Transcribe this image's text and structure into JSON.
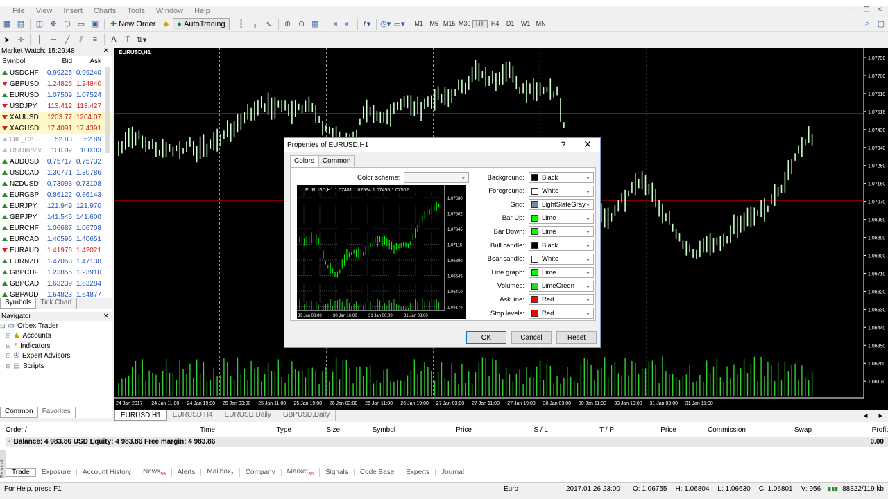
{
  "menu": [
    "File",
    "View",
    "Insert",
    "Charts",
    "Tools",
    "Window",
    "Help"
  ],
  "toolbar": {
    "new_order": "New Order",
    "autotrading": "AutoTrading",
    "timeframes": [
      "M1",
      "M5",
      "M15",
      "M30",
      "H1",
      "H4",
      "D1",
      "W1",
      "MN"
    ],
    "selected_tf": "H1"
  },
  "market_watch": {
    "title": "Market Watch: 15:29:48",
    "columns": [
      "Symbol",
      "Bid",
      "Ask"
    ],
    "rows": [
      {
        "s": "USDCHF",
        "bid": "0.99225",
        "ask": "0.99240",
        "dir": "up",
        "hl": false
      },
      {
        "s": "GBPUSD",
        "bid": "1.24825",
        "ask": "1.24840",
        "dir": "dn",
        "hl": false
      },
      {
        "s": "EURUSD",
        "bid": "1.07509",
        "ask": "1.07524",
        "dir": "up",
        "hl": false
      },
      {
        "s": "USDJPY",
        "bid": "113.412",
        "ask": "113.427",
        "dir": "dn",
        "hl": false
      },
      {
        "s": "XAUUSD",
        "bid": "1203.77",
        "ask": "1204.07",
        "dir": "dn",
        "hl": true
      },
      {
        "s": "XAGUSD",
        "bid": "17.4091",
        "ask": "17.4391",
        "dir": "dn",
        "hl": true
      },
      {
        "s": "OIL_Ch...",
        "bid": "52.83",
        "ask": "52.89",
        "dir": "gr",
        "hl": false
      },
      {
        "s": "USDIndex",
        "bid": "100.02",
        "ask": "100.03",
        "dir": "gr",
        "hl": false
      },
      {
        "s": "AUDUSD",
        "bid": "0.75717",
        "ask": "0.75732",
        "dir": "up",
        "hl": false
      },
      {
        "s": "USDCAD",
        "bid": "1.30771",
        "ask": "1.30786",
        "dir": "up",
        "hl": false
      },
      {
        "s": "NZDUSD",
        "bid": "0.73093",
        "ask": "0.73108",
        "dir": "up",
        "hl": false
      },
      {
        "s": "EURGBP",
        "bid": "0.86122",
        "ask": "0.86143",
        "dir": "up",
        "hl": false
      },
      {
        "s": "EURJPY",
        "bid": "121.949",
        "ask": "121.970",
        "dir": "up",
        "hl": false
      },
      {
        "s": "GBPJPY",
        "bid": "141.545",
        "ask": "141.600",
        "dir": "up",
        "hl": false
      },
      {
        "s": "EURCHF",
        "bid": "1.06687",
        "ask": "1.06708",
        "dir": "up",
        "hl": false
      },
      {
        "s": "EURCAD",
        "bid": "1.40596",
        "ask": "1.40651",
        "dir": "up",
        "hl": false
      },
      {
        "s": "EURAUD",
        "bid": "1.41976",
        "ask": "1.42021",
        "dir": "dn",
        "hl": false
      },
      {
        "s": "EURNZD",
        "bid": "1.47053",
        "ask": "1.47138",
        "dir": "up",
        "hl": false
      },
      {
        "s": "GBPCHF",
        "bid": "1.23855",
        "ask": "1.23910",
        "dir": "up",
        "hl": false
      },
      {
        "s": "GBPCAD",
        "bid": "1.63239",
        "ask": "1.63284",
        "dir": "up",
        "hl": false
      },
      {
        "s": "GBPAUD",
        "bid": "1.64823",
        "ask": "1.64877",
        "dir": "up",
        "hl": false
      }
    ],
    "tabs": [
      "Symbols",
      "Tick Chart"
    ]
  },
  "navigator": {
    "title": "Navigator",
    "items": [
      "Orbex Trader",
      "Accounts",
      "Indicators",
      "Expert Advisors",
      "Scripts"
    ],
    "tabs": [
      "Common",
      "Favorites"
    ]
  },
  "chart": {
    "title": "EURUSD,H1",
    "price_labels": [
      "1.07790",
      "1.07700",
      "1.07610",
      "1.07516",
      "1.07430",
      "1.07340",
      "1.07250",
      "1.07160",
      "1.07070",
      "1.06980",
      "1.06890",
      "1.06800",
      "1.06710",
      "1.06620",
      "1.06530",
      "1.06440",
      "1.06350",
      "1.06260",
      "1.06170"
    ],
    "time_labels": [
      "24 Jan 2017",
      "24 Jan 11:00",
      "24 Jan 19:00",
      "25 Jan 03:00",
      "25 Jan 11:00",
      "25 Jan 19:00",
      "26 Jan 03:00",
      "26 Jan 11:00",
      "26 Jan 19:00",
      "27 Jan 03:00",
      "27 Jan 11:00",
      "27 Jan 19:00",
      "30 Jan 03:00",
      "30 Jan 11:00",
      "30 Jan 19:00",
      "31 Jan 03:00",
      "31 Jan 11:00"
    ],
    "tabs": [
      "EURUSD,H1",
      "EURUSD,H4",
      "EURUSD,Daily",
      "GBPUSD,Daily"
    ],
    "colors": {
      "background": "#000000",
      "bars": "#00ff00",
      "grid": "#778899",
      "ask": "#ff0000"
    }
  },
  "dialog": {
    "title": "Properties of EURUSD,H1",
    "help": "?",
    "tabs": [
      "Colors",
      "Common"
    ],
    "color_scheme_label": "Color scheme:",
    "preview_header": "EURUSD,H1  1.07481 1.07594 1.07455 1.07502",
    "preview_prices": [
      "1.07580",
      "1.07502",
      "1.07345",
      "1.07115",
      "1.06880",
      "1.06645",
      "1.06410",
      "1.06175"
    ],
    "preview_times": [
      "30 Jan 08:00",
      "30 Jan 16:00",
      "31 Jan 00:00",
      "31 Jan 08:00"
    ],
    "props": [
      {
        "label": "Background:",
        "value": "Black",
        "color": "#000000"
      },
      {
        "label": "Foreground:",
        "value": "White",
        "color": "#ffffff"
      },
      {
        "label": "Grid:",
        "value": "LightSlateGray",
        "color": "#778899"
      },
      {
        "label": "Bar Up:",
        "value": "Lime",
        "color": "#00ff00"
      },
      {
        "label": "Bar Down:",
        "value": "Lime",
        "color": "#00ff00"
      },
      {
        "label": "Bull candle:",
        "value": "Black",
        "color": "#000000"
      },
      {
        "label": "Bear candle:",
        "value": "White",
        "color": "#ffffff"
      },
      {
        "label": "Line graph:",
        "value": "Lime",
        "color": "#00ff00"
      },
      {
        "label": "Volumes:",
        "value": "LimeGreen",
        "color": "#32cd32"
      },
      {
        "label": "Ask line:",
        "value": "Red",
        "color": "#ff0000"
      },
      {
        "label": "Stop levels:",
        "value": "Red",
        "color": "#ff0000"
      }
    ],
    "ok": "OK",
    "cancel": "Cancel",
    "reset": "Reset"
  },
  "terminal": {
    "columns": [
      "Order",
      "/",
      "Time",
      "Type",
      "Size",
      "Symbol",
      "Price",
      "S / L",
      "T / P",
      "Price",
      "Commission",
      "Swap",
      "Profit"
    ],
    "balance": "Balance: 4 983.86 USD  Equity: 4 983.86  Free margin: 4 983.86",
    "profit": "0.00",
    "side_label": "Terminal",
    "tabs": [
      {
        "t": "Trade",
        "n": ""
      },
      {
        "t": "Exposure",
        "n": ""
      },
      {
        "t": "Account History",
        "n": ""
      },
      {
        "t": "News",
        "n": "99"
      },
      {
        "t": "Alerts",
        "n": ""
      },
      {
        "t": "Mailbox",
        "n": "2"
      },
      {
        "t": "Company",
        "n": ""
      },
      {
        "t": "Market",
        "n": "36"
      },
      {
        "t": "Signals",
        "n": ""
      },
      {
        "t": "Code Base",
        "n": ""
      },
      {
        "t": "Experts",
        "n": ""
      },
      {
        "t": "Journal",
        "n": ""
      }
    ]
  },
  "status": {
    "help": "For Help, press F1",
    "profile": "Euro",
    "datetime": "2017.01.26 23:00",
    "open": "O: 1.06755",
    "high": "H: 1.06804",
    "low": "L: 1.06630",
    "close": "C: 1.06801",
    "volume": "V: 956",
    "traffic": "88322/119 kb"
  }
}
